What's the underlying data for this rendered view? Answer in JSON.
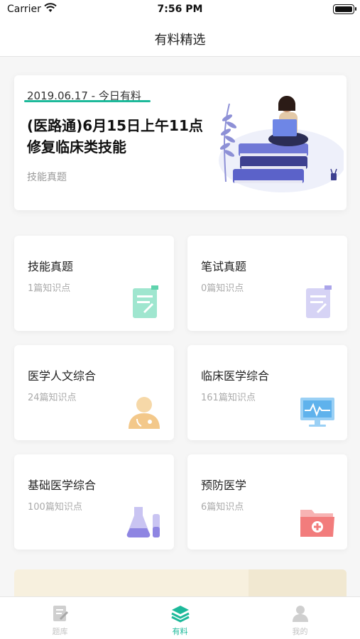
{
  "status_bar": {
    "carrier": "Carrier",
    "time": "7:56 PM"
  },
  "nav": {
    "title": "有料精选"
  },
  "featured": {
    "date": "2019.06.17 - 今日有料",
    "headline": "(医路通)6月15日上午11点修复临床类技能",
    "category": "技能真题"
  },
  "cards": [
    {
      "title": "技能真题",
      "count": "1篇知识点",
      "icon": "document-icon"
    },
    {
      "title": "笔试真题",
      "count": "0篇知识点",
      "icon": "document-icon"
    },
    {
      "title": "医学人文综合",
      "count": "24篇知识点",
      "icon": "doctor-icon"
    },
    {
      "title": "临床医学综合",
      "count": "161篇知识点",
      "icon": "monitor-icon"
    },
    {
      "title": "基础医学综合",
      "count": "100篇知识点",
      "icon": "flask-icon"
    },
    {
      "title": "预防医学",
      "count": "6篇知识点",
      "icon": "medical-folder-icon"
    }
  ],
  "tabs": [
    {
      "label": "题库",
      "icon": "edit-note-icon",
      "active": false
    },
    {
      "label": "有料",
      "icon": "layers-icon",
      "active": true
    },
    {
      "label": "我的",
      "icon": "user-icon",
      "active": false
    }
  ],
  "colors": {
    "accent": "#1db99a",
    "promo_bg": "#f7f0de"
  }
}
